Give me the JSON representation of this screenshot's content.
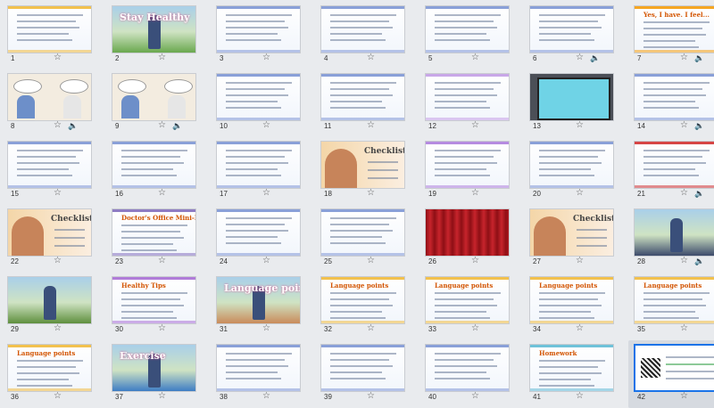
{
  "app": {
    "view": "slide-sorter"
  },
  "slides": [
    {
      "n": "1",
      "theme": "doc",
      "accent": "#f2c14e",
      "audio": false,
      "title": ""
    },
    {
      "n": "2",
      "theme": "photo",
      "accent": "#6aa84f",
      "audio": false,
      "title": "Stay Healthy"
    },
    {
      "n": "3",
      "theme": "doc",
      "accent": "#8aa0d8",
      "audio": false,
      "title": ""
    },
    {
      "n": "4",
      "theme": "doc",
      "accent": "#8aa0d8",
      "audio": false,
      "title": ""
    },
    {
      "n": "5",
      "theme": "doc",
      "accent": "#8aa0d8",
      "audio": false,
      "title": ""
    },
    {
      "n": "6",
      "theme": "doc",
      "accent": "#8aa0d8",
      "audio": true,
      "title": ""
    },
    {
      "n": "7",
      "theme": "doc",
      "accent": "#f5a623",
      "audio": true,
      "title": "Yes, I have. I feel..."
    },
    {
      "n": "8",
      "theme": "comic",
      "accent": "#d9c7a5",
      "audio": true,
      "title": ""
    },
    {
      "n": "9",
      "theme": "comic",
      "accent": "#d9c7a5",
      "audio": true,
      "title": ""
    },
    {
      "n": "10",
      "theme": "doc",
      "accent": "#8aa0d8",
      "audio": false,
      "title": ""
    },
    {
      "n": "11",
      "theme": "doc",
      "accent": "#8aa0d8",
      "audio": false,
      "title": ""
    },
    {
      "n": "12",
      "theme": "doc",
      "accent": "#c9a7e8",
      "audio": false,
      "title": ""
    },
    {
      "n": "13",
      "theme": "cyan",
      "accent": "#6fd3e6",
      "audio": false,
      "title": ""
    },
    {
      "n": "14",
      "theme": "doc",
      "accent": "#8aa0d8",
      "audio": true,
      "title": ""
    },
    {
      "n": "15",
      "theme": "doc",
      "accent": "#8aa0d8",
      "audio": false,
      "title": ""
    },
    {
      "n": "16",
      "theme": "doc",
      "accent": "#8aa0d8",
      "audio": false,
      "title": ""
    },
    {
      "n": "17",
      "theme": "doc",
      "accent": "#8aa0d8",
      "audio": false,
      "title": ""
    },
    {
      "n": "18",
      "theme": "checklist",
      "accent": "#f0c27b",
      "audio": false,
      "title": "Checklist"
    },
    {
      "n": "19",
      "theme": "doc",
      "accent": "#b58be0",
      "audio": false,
      "title": ""
    },
    {
      "n": "20",
      "theme": "doc",
      "accent": "#8aa0d8",
      "audio": false,
      "title": ""
    },
    {
      "n": "21",
      "theme": "doc",
      "accent": "#d64545",
      "audio": true,
      "title": ""
    },
    {
      "n": "22",
      "theme": "checklist",
      "accent": "#f0c27b",
      "audio": false,
      "title": "Checklist"
    },
    {
      "n": "23",
      "theme": "doc",
      "accent": "#8e7cc3",
      "audio": false,
      "title": "Doctor's Office Mini-Play"
    },
    {
      "n": "24",
      "theme": "doc",
      "accent": "#8aa0d8",
      "audio": false,
      "title": ""
    },
    {
      "n": "25",
      "theme": "doc",
      "accent": "#8aa0d8",
      "audio": false,
      "title": ""
    },
    {
      "n": "26",
      "theme": "curtain",
      "accent": "#b5161e",
      "audio": false,
      "title": ""
    },
    {
      "n": "27",
      "theme": "checklist",
      "accent": "#f0c27b",
      "audio": false,
      "title": "Checklist"
    },
    {
      "n": "28",
      "theme": "photo",
      "accent": "#3c4a6b",
      "audio": true,
      "title": ""
    },
    {
      "n": "29",
      "theme": "photo",
      "accent": "#5f8f3e",
      "audio": false,
      "title": ""
    },
    {
      "n": "30",
      "theme": "doc",
      "accent": "#b07cd8",
      "audio": false,
      "title": "Healthy Tips"
    },
    {
      "n": "31",
      "theme": "photo",
      "accent": "#c98b5b",
      "audio": false,
      "title": "Language points"
    },
    {
      "n": "32",
      "theme": "doc",
      "accent": "#f2c14e",
      "audio": false,
      "title": "Language points"
    },
    {
      "n": "33",
      "theme": "doc",
      "accent": "#f2c14e",
      "audio": false,
      "title": "Language points"
    },
    {
      "n": "34",
      "theme": "doc",
      "accent": "#f2c14e",
      "audio": false,
      "title": "Language points"
    },
    {
      "n": "35",
      "theme": "doc",
      "accent": "#f2c14e",
      "audio": false,
      "title": "Language points"
    },
    {
      "n": "36",
      "theme": "doc",
      "accent": "#f2c14e",
      "audio": false,
      "title": "Language points"
    },
    {
      "n": "37",
      "theme": "photo",
      "accent": "#3e7dc4",
      "audio": false,
      "title": "Exercise"
    },
    {
      "n": "38",
      "theme": "doc",
      "accent": "#8aa0d8",
      "audio": false,
      "title": ""
    },
    {
      "n": "39",
      "theme": "doc",
      "accent": "#8aa0d8",
      "audio": false,
      "title": ""
    },
    {
      "n": "40",
      "theme": "doc",
      "accent": "#8aa0d8",
      "audio": false,
      "title": ""
    },
    {
      "n": "41",
      "theme": "doc",
      "accent": "#6fc2d9",
      "audio": false,
      "title": "Homework"
    },
    {
      "n": "42",
      "theme": "qr",
      "accent": "#2f9e44",
      "audio": false,
      "title": ""
    }
  ],
  "selected": "42",
  "icons": {
    "star": "star-icon",
    "audio": "speaker-icon"
  },
  "symbols": {
    "star": "☆",
    "audio": "🔈"
  }
}
